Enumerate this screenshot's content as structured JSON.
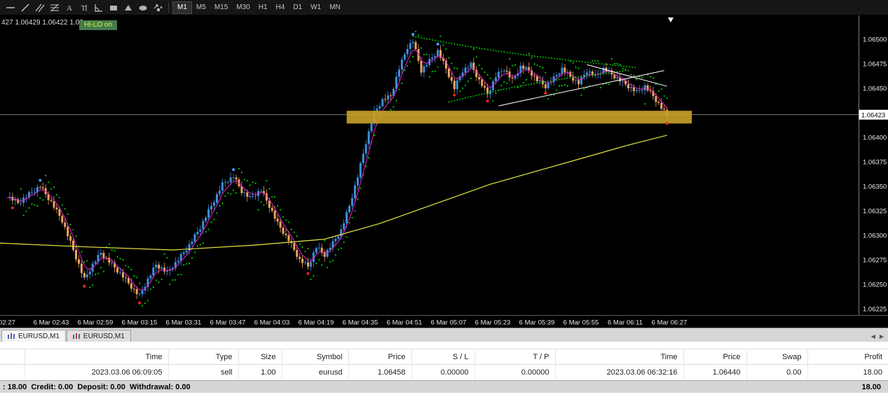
{
  "toolbar": {
    "timeframes": [
      "M1",
      "M5",
      "M15",
      "M30",
      "H1",
      "H4",
      "D1",
      "W1",
      "MN"
    ],
    "active_timeframe": "M1",
    "tools": [
      "horizontal-line",
      "trendline",
      "channel",
      "fibonacci",
      "text",
      "label",
      "angle",
      "rectangle",
      "triangle",
      "ellipse",
      "arrows-dropdown"
    ]
  },
  "chart_data": {
    "type": "candlestick",
    "symbol": "EURUSD",
    "timeframe": "M1",
    "ohlc_text": "427 1.06429 1.06422 1.06",
    "badge": "Hi-LO on",
    "current_price": "1.06423",
    "current_price_value": 1.06423,
    "ylim": [
      1.0622,
      1.0652
    ],
    "axis_prices": [
      "1.06500",
      "1.06475",
      "1.06450",
      "1.06400",
      "1.06375",
      "1.06350",
      "1.06325",
      "1.06300",
      "1.06275",
      "1.06250",
      "1.06225"
    ],
    "time_labels": [
      "02:27",
      "6 Mar 02:43",
      "6 Mar 02:59",
      "6 Mar 03:15",
      "6 Mar 03:31",
      "6 Mar 03:47",
      "6 Mar 04:03",
      "6 Mar 04:19",
      "6 Mar 04:35",
      "6 Mar 04:51",
      "6 Mar 05:07",
      "6 Mar 05:23",
      "6 Mar 05:39",
      "6 Mar 05:55",
      "6 Mar 06:11",
      "6 Mar 06:27"
    ],
    "price_path": [
      [
        0,
        1.0634
      ],
      [
        4,
        1.06333
      ],
      [
        8,
        1.06342
      ],
      [
        12,
        1.0635
      ],
      [
        16,
        1.06334
      ],
      [
        20,
        1.06315
      ],
      [
        24,
        1.06285
      ],
      [
        28,
        1.06255
      ],
      [
        31,
        1.0627
      ],
      [
        34,
        1.06282
      ],
      [
        38,
        1.0627
      ],
      [
        42,
        1.06258
      ],
      [
        46,
        1.06244
      ],
      [
        48,
        1.06238
      ],
      [
        51,
        1.06255
      ],
      [
        54,
        1.0627
      ],
      [
        58,
        1.06262
      ],
      [
        62,
        1.06275
      ],
      [
        66,
        1.0629
      ],
      [
        70,
        1.06308
      ],
      [
        74,
        1.0633
      ],
      [
        78,
        1.06352
      ],
      [
        82,
        1.0636
      ],
      [
        85,
        1.06345
      ],
      [
        88,
        1.06338
      ],
      [
        92,
        1.06346
      ],
      [
        95,
        1.0633
      ],
      [
        98,
        1.06312
      ],
      [
        102,
        1.06295
      ],
      [
        106,
        1.06275
      ],
      [
        109,
        1.06268
      ],
      [
        112,
        1.06288
      ],
      [
        115,
        1.0628
      ],
      [
        118,
        1.06292
      ],
      [
        121,
        1.06305
      ],
      [
        124,
        1.0633
      ],
      [
        127,
        1.0636
      ],
      [
        130,
        1.06395
      ],
      [
        133,
        1.06425
      ],
      [
        136,
        1.06438
      ],
      [
        139,
        1.06442
      ],
      [
        142,
        1.0647
      ],
      [
        145,
        1.06492
      ],
      [
        147,
        1.06498
      ],
      [
        150,
        1.06468
      ],
      [
        153,
        1.06478
      ],
      [
        156,
        1.06488
      ],
      [
        159,
        1.0647
      ],
      [
        162,
        1.0645
      ],
      [
        165,
        1.06468
      ],
      [
        168,
        1.06474
      ],
      [
        171,
        1.06458
      ],
      [
        174,
        1.06444
      ],
      [
        177,
        1.06462
      ],
      [
        180,
        1.0647
      ],
      [
        183,
        1.06458
      ],
      [
        186,
        1.06472
      ],
      [
        189,
        1.06468
      ],
      [
        192,
        1.06458
      ],
      [
        195,
        1.06452
      ],
      [
        198,
        1.0646
      ],
      [
        201,
        1.0647
      ],
      [
        204,
        1.06462
      ],
      [
        207,
        1.06455
      ],
      [
        210,
        1.06468
      ],
      [
        213,
        1.06462
      ],
      [
        216,
        1.0647
      ],
      [
        219,
        1.06464
      ],
      [
        222,
        1.06458
      ],
      [
        225,
        1.06452
      ],
      [
        228,
        1.06446
      ],
      [
        231,
        1.06452
      ],
      [
        234,
        1.06442
      ],
      [
        236,
        1.06434
      ],
      [
        238,
        1.06426
      ],
      [
        239,
        1.06422
      ]
    ],
    "yellow_ma": [
      [
        -3,
        1.06292
      ],
      [
        30,
        1.06288
      ],
      [
        60,
        1.06285
      ],
      [
        90,
        1.0629
      ],
      [
        115,
        1.06296
      ],
      [
        135,
        1.06312
      ],
      [
        155,
        1.06332
      ],
      [
        175,
        1.06352
      ],
      [
        195,
        1.06368
      ],
      [
        210,
        1.0638
      ],
      [
        225,
        1.06392
      ],
      [
        239,
        1.06402
      ]
    ],
    "zone": {
      "m1": 123,
      "m2": 248,
      "top": 1.06427,
      "bottom": 1.06414
    },
    "red_dots": [
      [
        2,
        1.06328
      ],
      [
        28,
        1.06248
      ],
      [
        48,
        1.06231
      ],
      [
        109,
        1.06261
      ],
      [
        162,
        1.06443
      ],
      [
        174,
        1.06437
      ],
      [
        195,
        1.06445
      ],
      [
        239,
        1.06414
      ]
    ],
    "blue_dots": [
      [
        12,
        1.06356
      ],
      [
        82,
        1.06367
      ],
      [
        147,
        1.06505
      ],
      [
        156,
        1.06495
      ]
    ],
    "green_dotted": [
      [
        [
          147,
          1.06503
        ],
        [
          160,
          1.06496
        ],
        [
          175,
          1.06489
        ],
        [
          190,
          1.06483
        ],
        [
          205,
          1.06478
        ],
        [
          218,
          1.06474
        ],
        [
          228,
          1.06471
        ]
      ],
      [
        [
          160,
          1.06436
        ],
        [
          172,
          1.06444
        ],
        [
          185,
          1.06452
        ],
        [
          200,
          1.06459
        ],
        [
          213,
          1.06464
        ],
        [
          224,
          1.06468
        ]
      ]
    ],
    "white_lines": [
      [
        [
          178,
          1.06432
        ],
        [
          238,
          1.06468
        ]
      ],
      [
        [
          210,
          1.06474
        ],
        [
          239,
          1.06452
        ]
      ]
    ],
    "colors": {
      "up": "#3f8fdd",
      "down": "#eda55f",
      "ma_fast": "#e822cc",
      "ma_slow": "#e6e642",
      "sar": "#00c800",
      "signal_low": "#ff2222",
      "signal_high": "#3fa0ff",
      "zone": "#c9a227",
      "price_line": "#c8c8c8",
      "axis_text": "#e8e8e8",
      "background": "#000000"
    }
  },
  "tabs": {
    "items": [
      "EURUSD,M1",
      "EURUSD,M1"
    ]
  },
  "table": {
    "headers": [
      "",
      "Time",
      "Type",
      "Size",
      "Symbol",
      "Price",
      "S / L",
      "T / P",
      "Time",
      "Price",
      "Swap",
      "Profit"
    ],
    "rows": [
      [
        "",
        "2023.03.06 06:09:05",
        "sell",
        "1.00",
        "eurusd",
        "1.06458",
        "0.00000",
        "0.00000",
        "2023.03.06 06:32:16",
        "1.06440",
        "0.00",
        "18.00"
      ]
    ]
  },
  "status_bar": {
    "left": ": 18.00  Credit: 0.00  Deposit: 0.00  Withdrawal: 0.00",
    "right": "18.00"
  }
}
